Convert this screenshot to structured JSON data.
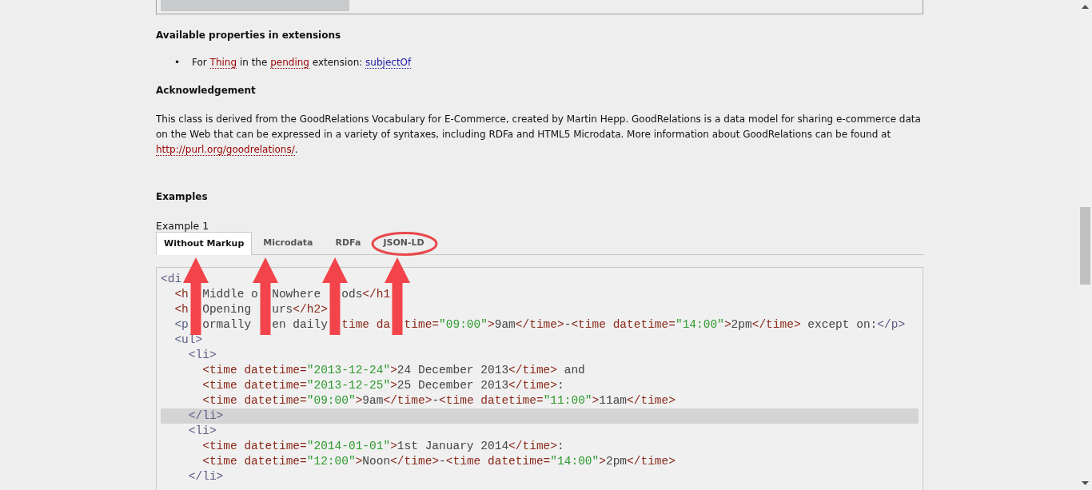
{
  "extensions_heading": "Available properties in extensions",
  "extensions_items": [
    {
      "marker": "•",
      "segments": [
        {
          "kind": "text",
          "text": "For "
        },
        {
          "kind": "link",
          "text": "Thing",
          "color": "#990000"
        },
        {
          "kind": "text",
          "text": " in the "
        },
        {
          "kind": "link",
          "text": "pending",
          "color": "#990000"
        },
        {
          "kind": "text",
          "text": " extension: "
        },
        {
          "kind": "link",
          "text": "subjectOf",
          "color": "#1a1aa6"
        }
      ]
    }
  ],
  "acknowledgement_heading": "Acknowledgement",
  "acknowledgement": [
    {
      "kind": "text",
      "text": "This class is derived from the GoodRelations Vocabulary for E-Commerce, created by Martin Hepp. GoodRelations is a data model for sharing e-commerce data on the Web that can be expressed in a variety of syntaxes, including RDFa and HTML5 Microdata. More information about GoodRelations can be found at "
    },
    {
      "kind": "link",
      "text": "http://purl.org/goodrelations/",
      "color": "#990000"
    },
    {
      "kind": "text",
      "text": "."
    }
  ],
  "examples_heading": "Examples",
  "example_label": "Example 1",
  "tabs": [
    {
      "label": "Without Markup",
      "selected": true,
      "circled": false
    },
    {
      "label": "Microdata",
      "selected": false,
      "circled": false
    },
    {
      "label": "RDFa",
      "selected": false,
      "circled": false
    },
    {
      "label": "JSON-LD",
      "selected": false,
      "circled": true
    }
  ],
  "code_lines": [
    {
      "highlighted": false,
      "pieces": [
        [
          {
            "kind": "tag",
            "text": "<di"
          }
        ]
      ]
    },
    {
      "highlighted": false,
      "pieces": [
        [
          {
            "kind": "element",
            "text": "  <h"
          }
        ],
        [
          {
            "kind": "text",
            "text": "Middle o"
          }
        ],
        [
          {
            "kind": "text",
            "text": "Nowhere "
          }
        ],
        [
          {
            "kind": "text",
            "text": "ods"
          },
          {
            "kind": "element",
            "text": "</h1"
          }
        ]
      ]
    },
    {
      "highlighted": false,
      "pieces": [
        [
          {
            "kind": "element",
            "text": "  <h"
          }
        ],
        [
          {
            "kind": "text",
            "text": "Opening "
          }
        ],
        [
          {
            "kind": "text",
            "text": "urs"
          },
          {
            "kind": "element",
            "text": "</h2>"
          }
        ]
      ]
    },
    {
      "highlighted": false,
      "pieces": [
        [
          {
            "kind": "tag",
            "text": "  <p"
          }
        ],
        [
          {
            "kind": "text",
            "text": "ormally "
          }
        ],
        [
          {
            "kind": "text",
            "text": "en daily"
          }
        ],
        [
          {
            "kind": "element",
            "text": "time da"
          }
        ],
        [
          {
            "kind": "element",
            "text": "time="
          },
          {
            "kind": "string",
            "text": "\"09:00\""
          },
          {
            "kind": "element",
            "text": ">"
          },
          {
            "kind": "text",
            "text": "9am"
          },
          {
            "kind": "element",
            "text": "</time>"
          },
          {
            "kind": "text",
            "text": "-"
          },
          {
            "kind": "element",
            "text": "<time datetime="
          },
          {
            "kind": "string",
            "text": "\"14:00\""
          },
          {
            "kind": "element",
            "text": ">"
          },
          {
            "kind": "text",
            "text": "2pm"
          },
          {
            "kind": "element",
            "text": "</time>"
          },
          {
            "kind": "text",
            "text": " except on:"
          },
          {
            "kind": "tag",
            "text": "</p>"
          }
        ]
      ]
    },
    {
      "highlighted": false,
      "pieces": [
        [
          {
            "kind": "tag",
            "text": "  <ul>"
          }
        ]
      ]
    },
    {
      "highlighted": false,
      "pieces": [
        [
          {
            "kind": "tag",
            "text": "    <li>"
          }
        ]
      ]
    },
    {
      "highlighted": false,
      "pieces": [
        [
          {
            "kind": "element",
            "text": "      <time datetime="
          },
          {
            "kind": "string",
            "text": "\"2013-12-24\""
          },
          {
            "kind": "element",
            "text": ">"
          },
          {
            "kind": "text",
            "text": "24 December 2013"
          },
          {
            "kind": "element",
            "text": "</time>"
          },
          {
            "kind": "text",
            "text": " and"
          }
        ]
      ]
    },
    {
      "highlighted": false,
      "pieces": [
        [
          {
            "kind": "element",
            "text": "      <time datetime="
          },
          {
            "kind": "string",
            "text": "\"2013-12-25\""
          },
          {
            "kind": "element",
            "text": ">"
          },
          {
            "kind": "text",
            "text": "25 December 2013"
          },
          {
            "kind": "element",
            "text": "</time>"
          },
          {
            "kind": "text",
            "text": ":"
          }
        ]
      ]
    },
    {
      "highlighted": false,
      "pieces": [
        [
          {
            "kind": "element",
            "text": "      <time datetime="
          },
          {
            "kind": "string",
            "text": "\"09:00\""
          },
          {
            "kind": "element",
            "text": ">"
          },
          {
            "kind": "text",
            "text": "9am"
          },
          {
            "kind": "element",
            "text": "</time>"
          },
          {
            "kind": "text",
            "text": "-"
          },
          {
            "kind": "element",
            "text": "<time datetime="
          },
          {
            "kind": "string",
            "text": "\"11:00\""
          },
          {
            "kind": "element",
            "text": ">"
          },
          {
            "kind": "text",
            "text": "11am"
          },
          {
            "kind": "element",
            "text": "</time>"
          }
        ]
      ]
    },
    {
      "highlighted": true,
      "pieces": [
        [
          {
            "kind": "tag",
            "text": "    </li>"
          }
        ]
      ]
    },
    {
      "highlighted": false,
      "pieces": [
        [
          {
            "kind": "tag",
            "text": "    <li>"
          }
        ]
      ]
    },
    {
      "highlighted": false,
      "pieces": [
        [
          {
            "kind": "element",
            "text": "      <time datetime="
          },
          {
            "kind": "string",
            "text": "\"2014-01-01\""
          },
          {
            "kind": "element",
            "text": ">"
          },
          {
            "kind": "text",
            "text": "1st January 2014"
          },
          {
            "kind": "element",
            "text": "</time>"
          },
          {
            "kind": "text",
            "text": ":"
          }
        ]
      ]
    },
    {
      "highlighted": false,
      "pieces": [
        [
          {
            "kind": "element",
            "text": "      <time datetime="
          },
          {
            "kind": "string",
            "text": "\"12:00\""
          },
          {
            "kind": "element",
            "text": ">"
          },
          {
            "kind": "text",
            "text": "Noon"
          },
          {
            "kind": "element",
            "text": "</time>"
          },
          {
            "kind": "text",
            "text": "-"
          },
          {
            "kind": "element",
            "text": "<time datetime="
          },
          {
            "kind": "string",
            "text": "\"14:00\""
          },
          {
            "kind": "element",
            "text": ">"
          },
          {
            "kind": "text",
            "text": "2pm"
          },
          {
            "kind": "element",
            "text": "</time>"
          }
        ]
      ]
    },
    {
      "highlighted": false,
      "pieces": [
        [
          {
            "kind": "tag",
            "text": "    </li>"
          }
        ]
      ]
    }
  ]
}
